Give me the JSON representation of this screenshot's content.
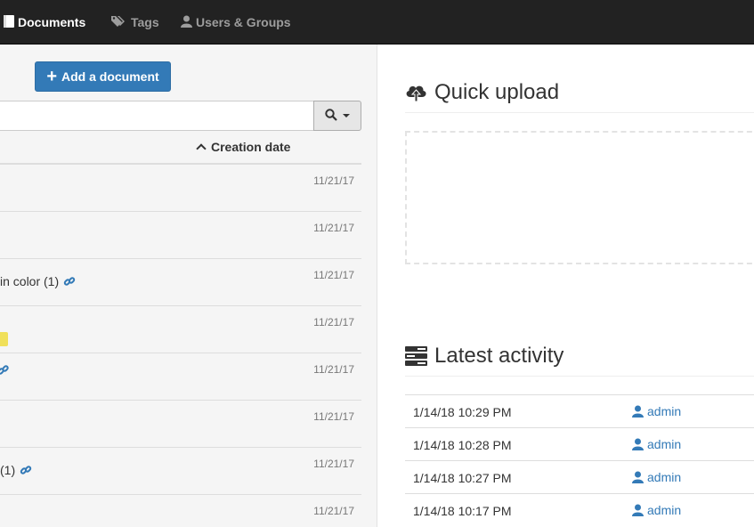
{
  "nav": {
    "documents": "Documents",
    "tags": "Tags",
    "users_groups": "Users & Groups"
  },
  "documents_panel": {
    "add_button": "Add a document",
    "search_value": "",
    "sort_column": "Creation date",
    "rows": [
      {
        "title": "",
        "date": "11/21/17"
      },
      {
        "title": "",
        "date": "11/21/17"
      },
      {
        "title": "in color (1)",
        "date": "11/21/17"
      },
      {
        "title": "",
        "date": "11/21/17"
      },
      {
        "title": "",
        "date": "11/21/17"
      },
      {
        "title": "",
        "date": "11/21/17"
      },
      {
        "title": "(1)",
        "date": "11/21/17"
      },
      {
        "title": "",
        "date": "11/21/17"
      }
    ]
  },
  "quick_upload": {
    "title": "Quick upload"
  },
  "latest_activity": {
    "title": "Latest activity",
    "rows": [
      {
        "when": "1/14/18 10:29 PM",
        "user": "admin"
      },
      {
        "when": "1/14/18 10:28 PM",
        "user": "admin"
      },
      {
        "when": "1/14/18 10:27 PM",
        "user": "admin"
      },
      {
        "when": "1/14/18 10:17 PM",
        "user": "admin"
      }
    ]
  },
  "colors": {
    "primary": "#337ab7",
    "navbar": "#222222",
    "tag_yellow": "#f0e05a"
  },
  "icons": {
    "documents": "book-icon",
    "tags": "tags-icon",
    "users": "user-icon",
    "upload": "cloud-upload-icon",
    "activity": "tasks-icon",
    "link": "link-icon"
  }
}
